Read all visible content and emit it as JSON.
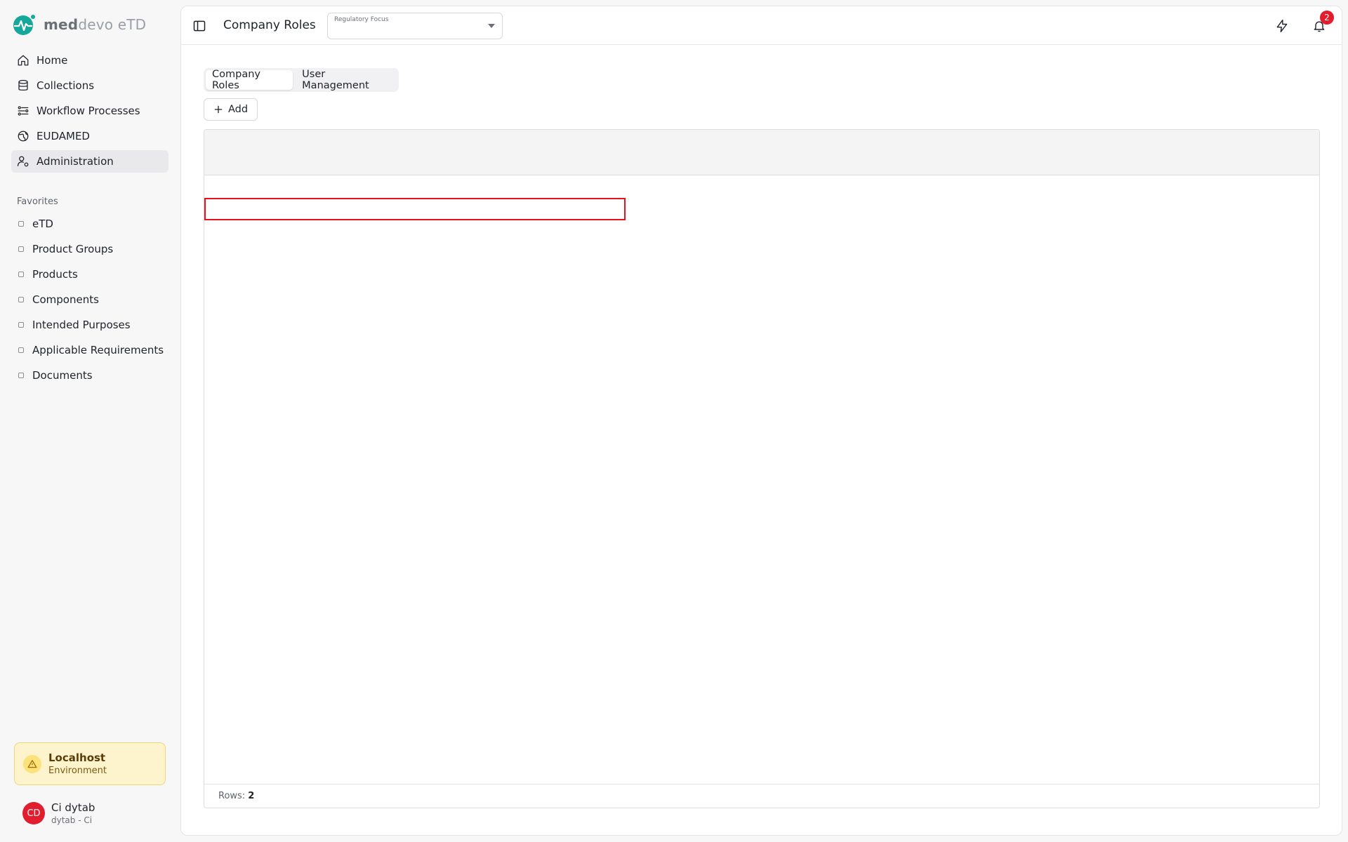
{
  "brand": {
    "name_bold": "med",
    "name_rest": "devo eTD",
    "accent": "#14a89a"
  },
  "nav": [
    {
      "label": "Home",
      "icon": "home-icon"
    },
    {
      "label": "Collections",
      "icon": "database-icon"
    },
    {
      "label": "Workflow Processes",
      "icon": "workflow-icon"
    },
    {
      "label": "EUDAMED",
      "icon": "globe-icon"
    },
    {
      "label": "Administration",
      "icon": "user-cog-icon",
      "active": true
    }
  ],
  "favorites": {
    "title": "Favorites",
    "items": [
      "eTD",
      "Product Groups",
      "Products",
      "Components",
      "Intended Purposes",
      "Applicable Requirements",
      "Documents"
    ]
  },
  "environment": {
    "title": "Localhost",
    "subtitle": "Environment"
  },
  "user": {
    "initials": "CD",
    "name": "Ci dytab",
    "subtitle": "dytab - Ci"
  },
  "header": {
    "title": "Company Roles",
    "regulatory_focus_label": "Regulatory Focus",
    "notification_count": "2"
  },
  "tabs": [
    {
      "label": "Company Roles",
      "active": true
    },
    {
      "label": "User Management",
      "active": false
    }
  ],
  "toolbar": {
    "add_label": "Add"
  },
  "grid": {
    "rows_label": "Rows:",
    "rows_count": "2"
  },
  "colors": {
    "badge": "#e11d2e",
    "highlight": "#e8121d",
    "env_bg": "#fdf3cc"
  }
}
